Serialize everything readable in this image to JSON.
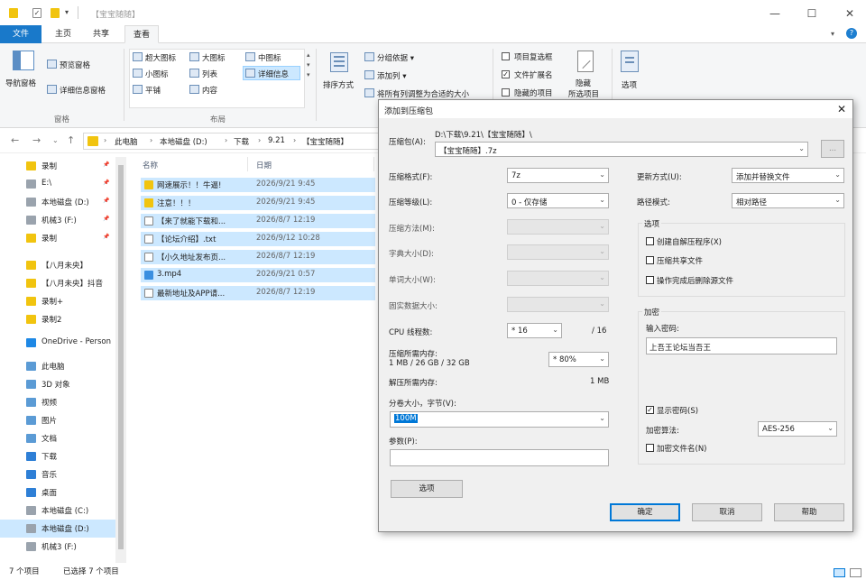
{
  "window": {
    "title": "【宝宝随随】"
  },
  "ribbon": {
    "tabs": [
      "文件",
      "主页",
      "共享",
      "查看"
    ],
    "pane_group": {
      "nav_pane": "导航窗格",
      "preview": "预览窗格",
      "details": "详细信息窗格",
      "label": "窗格"
    },
    "layout_group": {
      "items": [
        "超大图标",
        "大图标",
        "中图标",
        "小图标",
        "列表",
        "详细信息",
        "平铺",
        "内容"
      ],
      "label": "布局"
    },
    "view_group": {
      "sort": "排序方式",
      "group_by": "分组依据 ▾",
      "add_col": "添加列 ▾",
      "fit_cols": "将所有列调整为合适的大小"
    },
    "show_group": {
      "checkbox_items": "项目复选框",
      "extensions": "文件扩展名",
      "hidden_items": "隐藏的项目",
      "hide": "隐藏",
      "hide_selected": "所选项目"
    },
    "options": "选项"
  },
  "address": {
    "crumbs": [
      "此电脑",
      "本地磁盘 (D:)",
      "下载",
      "9.21",
      "【宝宝随随】"
    ]
  },
  "nav": {
    "items": [
      {
        "label": "录制",
        "pin": true,
        "color": "#f1c40f"
      },
      {
        "label": "E:\\",
        "pin": true,
        "color": "#9aa3ad"
      },
      {
        "label": "本地磁盘 (D:)",
        "pin": true,
        "color": "#9aa3ad"
      },
      {
        "label": "机械3 (F:)",
        "pin": true,
        "color": "#9aa3ad"
      },
      {
        "label": "录制",
        "pin": true,
        "color": "#f1c40f"
      },
      {
        "label": "【八月未央】",
        "pin": false,
        "color": "#f1c40f"
      },
      {
        "label": "【八月未央】抖音",
        "pin": false,
        "color": "#f1c40f"
      },
      {
        "label": "录制+",
        "pin": false,
        "color": "#f1c40f"
      },
      {
        "label": "录制2",
        "pin": false,
        "color": "#f1c40f"
      },
      {
        "label": "OneDrive - Person",
        "pin": false,
        "color": "#1e88e5"
      },
      {
        "label": "此电脑",
        "pin": false,
        "color": "#5b9bd5"
      },
      {
        "label": "3D 对象",
        "pin": false,
        "color": "#5b9bd5"
      },
      {
        "label": "视频",
        "pin": false,
        "color": "#5b9bd5"
      },
      {
        "label": "图片",
        "pin": false,
        "color": "#5b9bd5"
      },
      {
        "label": "文档",
        "pin": false,
        "color": "#5b9bd5"
      },
      {
        "label": "下载",
        "pin": false,
        "color": "#2e7fd6"
      },
      {
        "label": "音乐",
        "pin": false,
        "color": "#2e7fd6"
      },
      {
        "label": "桌面",
        "pin": false,
        "color": "#2e7fd6"
      },
      {
        "label": "本地磁盘 (C:)",
        "pin": false,
        "color": "#9aa3ad"
      },
      {
        "label": "本地磁盘 (D:)",
        "pin": false,
        "color": "#9aa3ad",
        "selected": true
      },
      {
        "label": "机械3 (F:)",
        "pin": false,
        "color": "#9aa3ad"
      }
    ]
  },
  "files": {
    "col_name": "名称",
    "col_date": "日期",
    "rows": [
      {
        "name": "网速展示！！牛逼!",
        "date": "2026/9/21 9:45",
        "type": "folder"
      },
      {
        "name": "注意！！！",
        "date": "2026/9/21 9:45",
        "type": "folder"
      },
      {
        "name": "【来了就能下载和...",
        "date": "2026/8/7 12:19",
        "type": "doc"
      },
      {
        "name": "【论坛介绍】.txt",
        "date": "2026/9/12 10:28",
        "type": "doc"
      },
      {
        "name": "【小久地址发布页...",
        "date": "2026/8/7 12:19",
        "type": "doc"
      },
      {
        "name": "3.mp4",
        "date": "2026/9/21 0:57",
        "type": "video"
      },
      {
        "name": "最新地址及APP请...",
        "date": "2026/8/7 12:19",
        "type": "doc"
      }
    ]
  },
  "status": {
    "count": "7 个项目",
    "selected": "已选择 7 个项目"
  },
  "dialog": {
    "title": "添加到压缩包",
    "archive_label": "压缩包(A):",
    "archive_path": "D:\\下载\\9.21\\【宝宝随随】\\",
    "archive_name": "【宝宝随随】.7z",
    "browse": "...",
    "format_label": "压缩格式(F):",
    "format": "7z",
    "level_label": "压缩等级(L):",
    "level": "0 - 仅存储",
    "method_label": "压缩方法(M):",
    "dict_label": "字典大小(D):",
    "word_label": "单词大小(W):",
    "solid_label": "固实数据大小:",
    "cpu_label": "CPU 线程数:",
    "cpu": "* 16",
    "cpu_max": "/ 16",
    "mem_label": "压缩所需内存:",
    "mem_detail": "1 MB / 26 GB / 32 GB",
    "mem_pct": "* 80%",
    "decomp_label": "解压所需内存:",
    "decomp_val": "1 MB",
    "split_label": "分卷大小，字节(V):",
    "split_val": "100M",
    "param_label": "参数(P):",
    "options_btn": "选项",
    "update_label": "更新方式(U):",
    "update": "添加并替换文件",
    "path_label": "路径模式:",
    "path": "相对路径",
    "opt_group": "选项",
    "opt_items": [
      "创建自解压程序(X)",
      "压缩共享文件",
      "操作完成后删除源文件"
    ],
    "enc_group": "加密",
    "pwd_label": "输入密码:",
    "pwd_val": "上吾王论坛当吾王",
    "show_pwd": "显示密码(S)",
    "enc_method_label": "加密算法:",
    "enc_method": "AES-256",
    "enc_names": "加密文件名(N)",
    "ok": "确定",
    "cancel": "取消",
    "help": "帮助"
  }
}
